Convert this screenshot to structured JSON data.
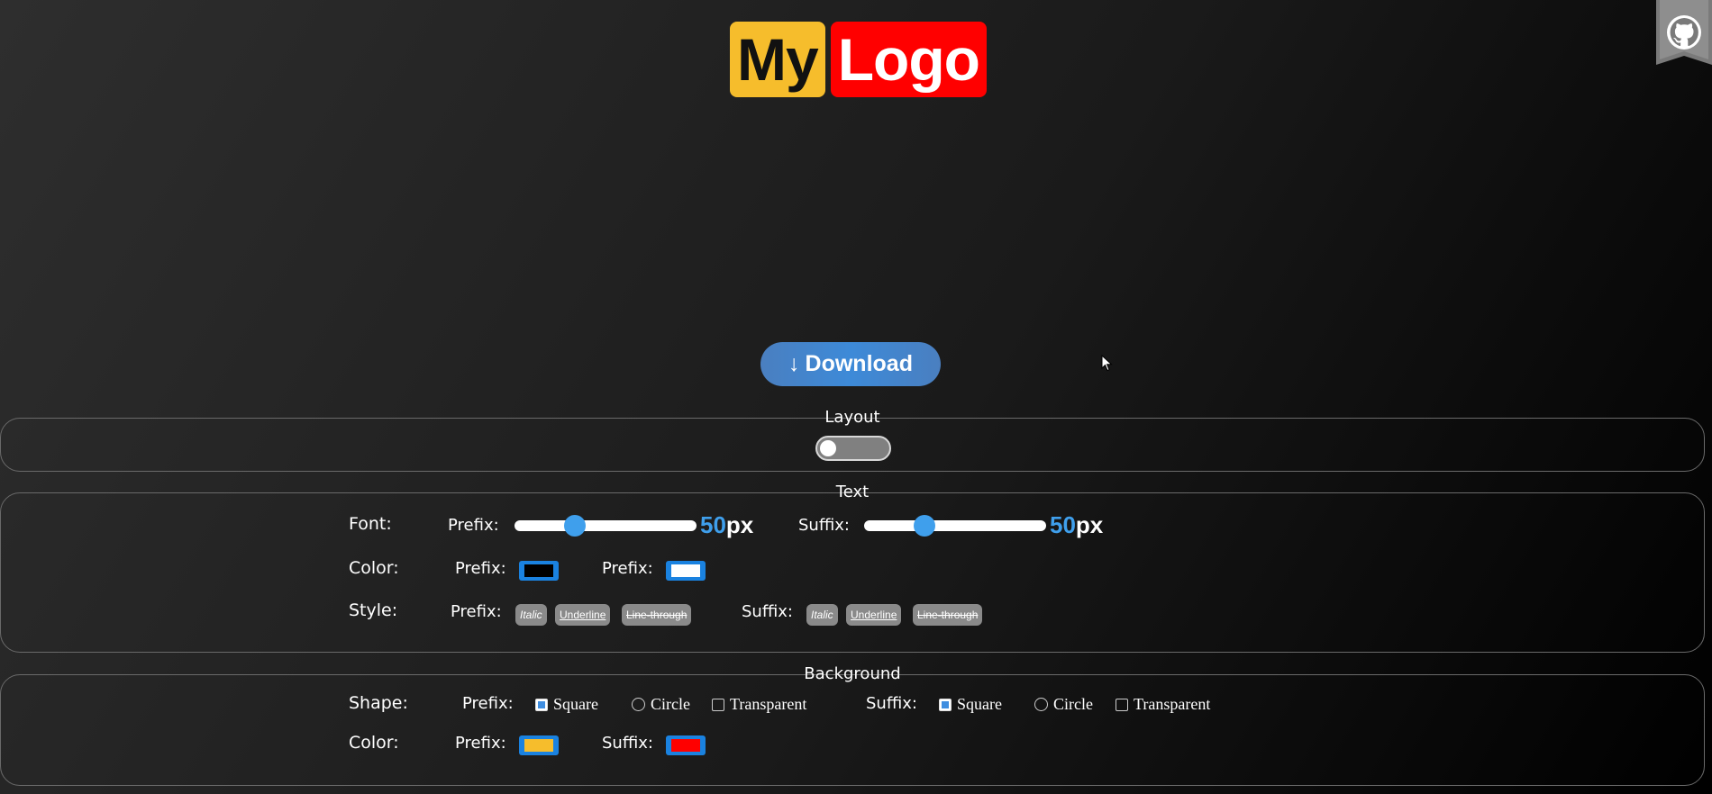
{
  "logo": {
    "prefix": "My",
    "suffix": "Logo"
  },
  "download": {
    "arrow": "↓",
    "label": "Download"
  },
  "layout": {
    "legend": "Layout",
    "toggle_on": false
  },
  "text": {
    "legend": "Text",
    "font": {
      "label": "Font:",
      "prefix_label": "Prefix:",
      "prefix_value": "50",
      "prefix_unit": "px",
      "prefix_level": 0.31,
      "suffix_label": "Suffix:",
      "suffix_value": "50",
      "suffix_unit": "px",
      "suffix_level": 0.31
    },
    "color": {
      "label": "Color:",
      "prefix_label": "Prefix:",
      "prefix_color": "#000000",
      "suffix_label": "Prefix:",
      "suffix_color": "#ffffff"
    },
    "style": {
      "label": "Style:",
      "prefix_label": "Prefix:",
      "suffix_label": "Suffix:",
      "chips": {
        "italic": "Italic",
        "underline": "Underline",
        "strike": "Line-through"
      }
    }
  },
  "background": {
    "legend": "Background",
    "shape": {
      "label": "Shape:",
      "prefix_label": "Prefix:",
      "suffix_label": "Suffix:",
      "options": {
        "square": "Square",
        "circle": "Circle",
        "transparent": "Transparent"
      },
      "prefix_selected": "square",
      "suffix_selected": "square"
    },
    "color": {
      "label": "Color:",
      "prefix_label": "Prefix:",
      "prefix_color": "#f6bd2c",
      "suffix_label": "Suffix:",
      "suffix_color": "#ff0000"
    }
  },
  "colors": {
    "accent": "#3f9fec",
    "logo_prefix_bg": "#f6bd2c",
    "logo_suffix_bg": "#ff0000"
  },
  "icons": {
    "github": "github-icon",
    "cursor": "mouse-cursor-icon",
    "arrow": "down-arrow-icon"
  }
}
